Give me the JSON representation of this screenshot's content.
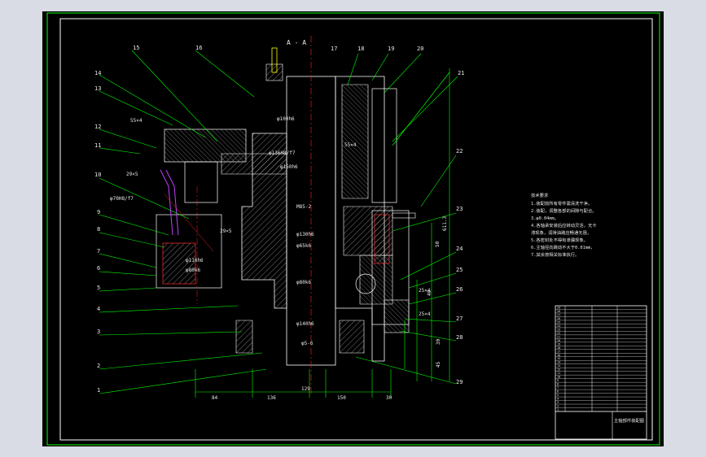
{
  "drawing": {
    "section_title": "A - A",
    "part_numbers": [
      "1",
      "2",
      "3",
      "4",
      "5",
      "6",
      "7",
      "8",
      "9",
      "10",
      "11",
      "12",
      "13",
      "14",
      "15",
      "16",
      "17",
      "18",
      "19",
      "20",
      "21",
      "22",
      "23",
      "24",
      "25",
      "26",
      "27",
      "28",
      "29"
    ],
    "dimensions": {
      "fit_1": "φ100h6",
      "fit_2": "φ136H8/f7",
      "fit_3": "φ150h6",
      "fit_4": "M85-2",
      "fit_5": "φ130h6",
      "fit_6": "φ65k6",
      "fit_7": "φ80k6",
      "fit_8": "φ140h6",
      "fit_9": "φ5-6",
      "fit_10": "φ70H8/f7",
      "fit_11": "φ110h6",
      "fit_12": "φ80k6",
      "chamfer_1": "55×4",
      "chamfer_2": "29×5",
      "chamfer_3": "29×5",
      "chamfer_4": "55×4",
      "chamfer_5": "25×4",
      "chamfer_6": "25×4",
      "bottom_1": "84",
      "bottom_2": "136",
      "bottom_3": "129",
      "bottom_4": "150",
      "bottom_5": "30",
      "vert_1": "611.3",
      "vert_2": "50",
      "vert_3": "30",
      "vert_4": "45",
      "vert_5": "40"
    }
  },
  "notes": {
    "heading": "技术要求",
    "lines": [
      "1.装配前所有零件需清洗干净。",
      "2.装配，调整各部的间隙与配合。",
      "3.φ0.04mm。",
      "4.各轴承安装后应转动灵活，无卡",
      "滞现象，润滑油路应畅通无阻，",
      "5.各密封处不得有渗漏现象，",
      "6.主轴径向跳动不大于0.01mm，",
      "7.其余按相关标准执行。"
    ]
  },
  "title_block": {
    "name": "主轴部件装配图",
    "rows": [
      "29",
      "28",
      "27",
      "26",
      "25",
      "24",
      "23",
      "22",
      "21",
      "20",
      "19",
      "18",
      "17",
      "16",
      "15",
      "14",
      "13",
      "12",
      "11",
      "10",
      "9",
      "8",
      "7",
      "6",
      "5",
      "4",
      "3",
      "2",
      "1"
    ]
  },
  "colors": {
    "sheet_bg": "#000000",
    "page_bg": "#d9dce4",
    "frame": "#00ff00",
    "outline": "#ffffff",
    "hatch": "#b0b0b0",
    "centerline": "#ff2020",
    "dimension": "#00ff00",
    "accent_purple": "#c040ff",
    "accent_yellow": "#ffff00"
  }
}
